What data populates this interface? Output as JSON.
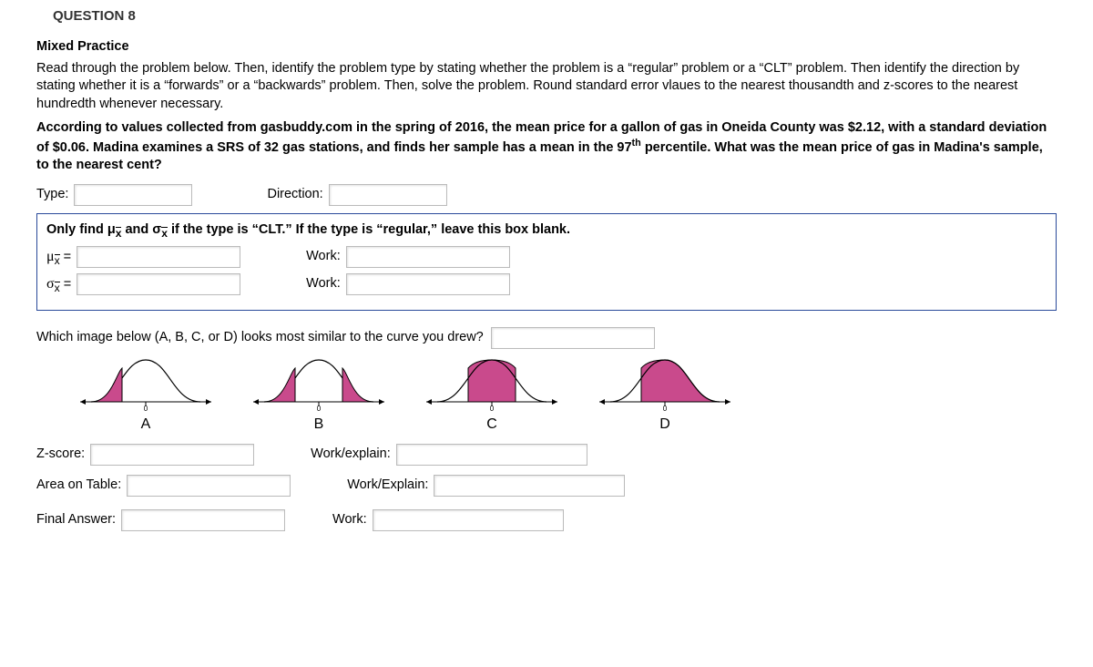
{
  "question_number": "QUESTION 8",
  "section_title": "Mixed Practice",
  "instructions": "Read through the problem below.  Then, identify the problem type by stating whether the problem is a “regular” problem or a “CLT” problem.  Then identify the direction by stating whether it is a “forwards” or a “backwards” problem.  Then, solve the problem.  Round standard error vlaues to the nearest thousandth and z-scores to the nearest hundredth whenever necessary.",
  "problem_text_1": "According to values collected from gasbuddy.com in the spring of 2016, the mean price for a gallon of gas in Oneida County was $2.12, with a standard deviation of $0.06.  Madina examines a SRS of 32 gas stations, and finds her sample has a mean in the 97",
  "problem_text_sup": "th",
  "problem_text_2": " percentile.  What was the mean price of gas in Madina's sample, to the nearest cent?",
  "labels": {
    "type": "Type:",
    "direction": "Direction:",
    "clt_header_1": "Only find μ",
    "clt_header_2": " and  σ",
    "clt_header_3": " if the type is “CLT.”  If the type is “regular,” leave this box blank.",
    "mu_label_sym": "μ",
    "sigma_label_sym": "σ",
    "equals": " =",
    "xbar_sub": "x̄",
    "work": "Work:",
    "which_image": "Which image below (A, B, C, or D) looks most similar to the curve you drew?",
    "zscore": "Z-score:",
    "work_explain": "Work/explain:",
    "area": "Area on Table:",
    "work_explain2": "Work/Explain:",
    "final": "Final Answer:",
    "work3": "Work:"
  },
  "curve_labels": {
    "a": "A",
    "b": "B",
    "c": "C",
    "d": "D"
  },
  "axis_zero": "0"
}
